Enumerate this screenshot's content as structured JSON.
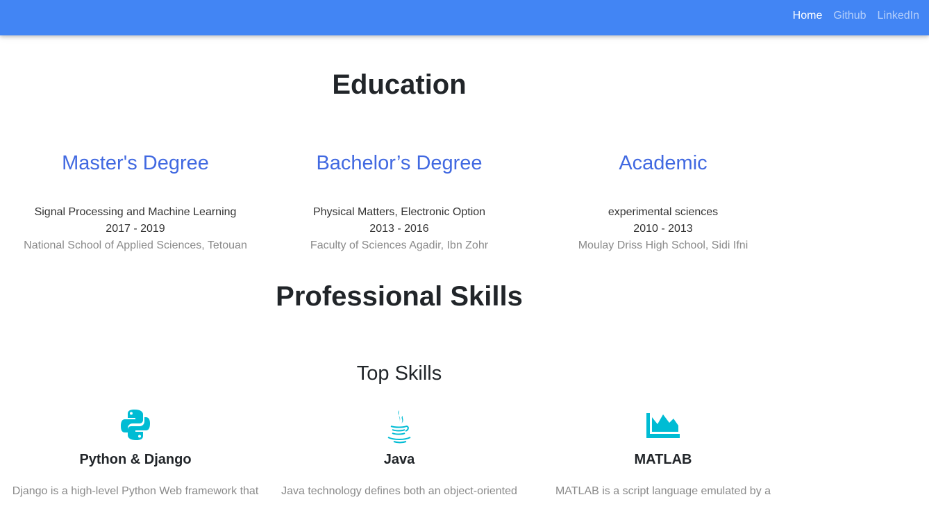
{
  "nav": {
    "links": [
      "Home",
      "Github",
      "LinkedIn"
    ]
  },
  "education": {
    "title": "Education",
    "items": [
      {
        "degree": "Master's Degree",
        "field": "Signal Processing and Machine Learning",
        "years": "2017 - 2019",
        "school": "National School of Applied Sciences, Tetouan"
      },
      {
        "degree": "Bachelor’s Degree",
        "field": "Physical Matters, Electronic Option",
        "years": "2013 - 2016",
        "school": "Faculty of Sciences Agadir, Ibn Zohr"
      },
      {
        "degree": "Academic",
        "field": "experimental sciences",
        "years": "2010 - 2013",
        "school": "Moulay Driss High School, Sidi Ifni"
      }
    ]
  },
  "skills": {
    "title": "Professional Skills",
    "subtitle": "Top Skills",
    "items": [
      {
        "icon": "python-icon",
        "name": "Python & Django",
        "description": "Django is a high-level Python Web framework that"
      },
      {
        "icon": "java-icon",
        "name": "Java",
        "description": "Java technology defines both an object-oriented"
      },
      {
        "icon": "area-chart-icon",
        "name": "MATLAB",
        "description": "MATLAB is a script language emulated by a"
      }
    ]
  },
  "colors": {
    "navbar": "#4285f4",
    "degree_title": "#4169e1",
    "icon": "#00bcd4"
  }
}
